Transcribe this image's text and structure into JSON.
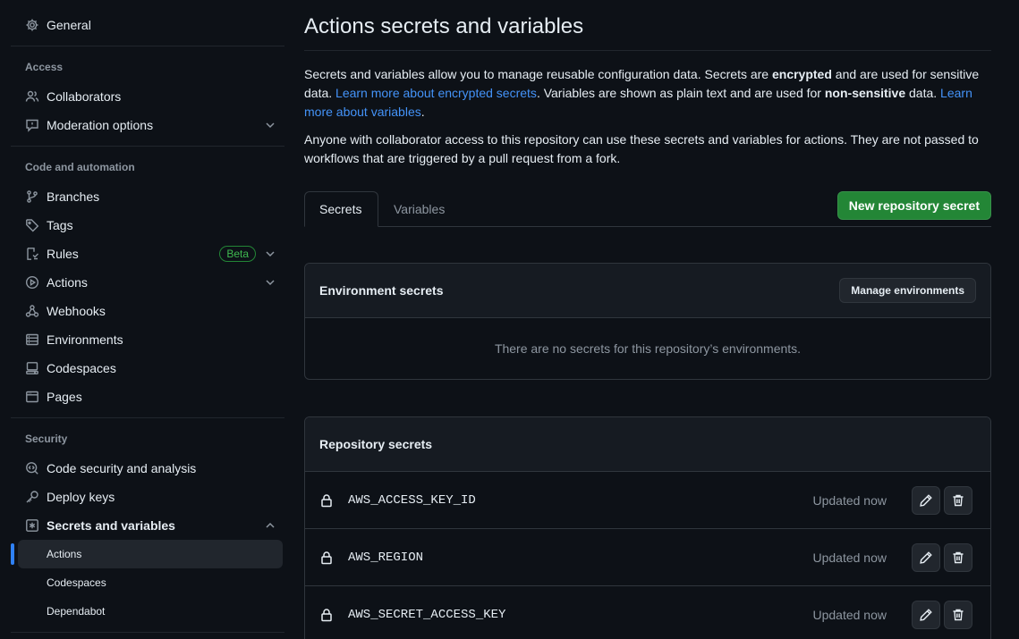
{
  "sidebar": {
    "general": "General",
    "access_heading": "Access",
    "collaborators": "Collaborators",
    "moderation": "Moderation options",
    "code_heading": "Code and automation",
    "branches": "Branches",
    "tags": "Tags",
    "rules": "Rules",
    "rules_badge": "Beta",
    "actions": "Actions",
    "webhooks": "Webhooks",
    "environments": "Environments",
    "codespaces": "Codespaces",
    "pages": "Pages",
    "security_heading": "Security",
    "code_security": "Code security and analysis",
    "deploy_keys": "Deploy keys",
    "secrets_vars": "Secrets and variables",
    "sub_actions": "Actions",
    "sub_codespaces": "Codespaces",
    "sub_dependabot": "Dependabot"
  },
  "main": {
    "title": "Actions secrets and variables",
    "p1_a": "Secrets and variables allow you to manage reusable configuration data. Secrets are ",
    "p1_b": "encrypted",
    "p1_c": " and are used for sensitive data. ",
    "p1_link1": "Learn more about encrypted secrets",
    "p1_d": ". Variables are shown as plain text and are used for ",
    "p1_e": "non-sensitive",
    "p1_f": " data. ",
    "p1_link2": "Learn more about variables",
    "p1_g": ".",
    "p2": "Anyone with collaborator access to this repository can use these secrets and variables for actions. They are not passed to workflows that are triggered by a pull request from a fork.",
    "tab_secrets": "Secrets",
    "tab_variables": "Variables",
    "new_secret": "New repository secret",
    "env_title": "Environment secrets",
    "manage_env": "Manage environments",
    "env_empty": "There are no secrets for this repository’s environments.",
    "repo_title": "Repository secrets",
    "secrets": [
      {
        "name": "AWS_ACCESS_KEY_ID",
        "updated": "Updated now"
      },
      {
        "name": "AWS_REGION",
        "updated": "Updated now"
      },
      {
        "name": "AWS_SECRET_ACCESS_KEY",
        "updated": "Updated now"
      }
    ]
  },
  "colors": {
    "background": "#0d1117",
    "accent_blue": "#4493f8",
    "primary_green": "#238636",
    "muted": "#8d96a0"
  },
  "icons": [
    "gear-icon",
    "people-icon",
    "report-icon",
    "git-branch-icon",
    "tag-icon",
    "rules-icon",
    "play-icon",
    "webhook-icon",
    "server-icon",
    "codespaces-icon",
    "browser-icon",
    "codescan-icon",
    "key-icon",
    "asterisk-icon",
    "chevron-down-icon",
    "chevron-up-icon",
    "lock-icon",
    "pencil-icon",
    "trash-icon"
  ]
}
